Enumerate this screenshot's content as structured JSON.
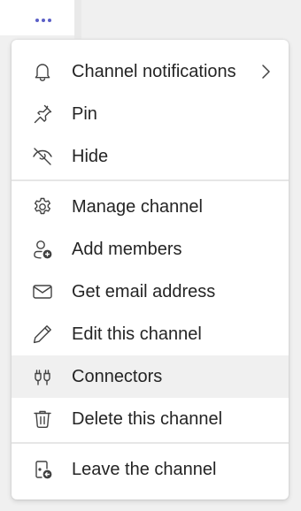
{
  "more_button": {
    "icon": "more-horizontal-icon",
    "color": "#5b5fc7"
  },
  "menu": {
    "hovered_item": "Connectors",
    "groups": [
      {
        "items": [
          {
            "label": "Channel notifications",
            "icon": "bell-icon",
            "has_submenu": true
          },
          {
            "label": "Pin",
            "icon": "pin-icon"
          },
          {
            "label": "Hide",
            "icon": "eye-off-icon"
          }
        ]
      },
      {
        "items": [
          {
            "label": "Manage channel",
            "icon": "gear-icon"
          },
          {
            "label": "Add members",
            "icon": "person-add-icon"
          },
          {
            "label": "Get email address",
            "icon": "mail-icon"
          },
          {
            "label": "Edit this channel",
            "icon": "pencil-icon"
          },
          {
            "label": "Connectors",
            "icon": "plug-icon"
          },
          {
            "label": "Delete this channel",
            "icon": "trash-icon"
          }
        ]
      },
      {
        "items": [
          {
            "label": "Leave the channel",
            "icon": "leave-door-icon"
          }
        ]
      }
    ]
  }
}
